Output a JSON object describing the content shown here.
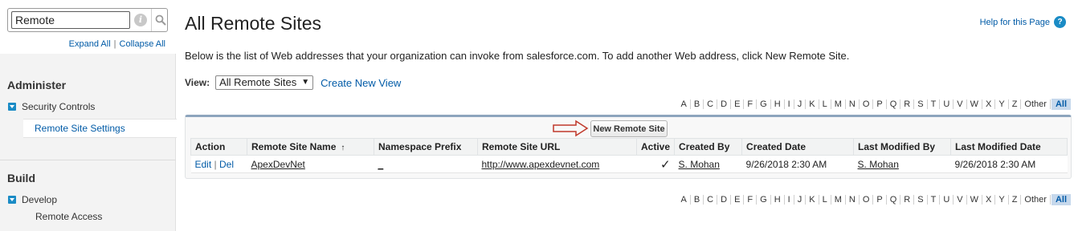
{
  "search": {
    "value": "Remote",
    "info_glyph": "i"
  },
  "sidebar": {
    "expand_all": "Expand All",
    "collapse_all": "Collapse All",
    "separator": "|",
    "sections": [
      {
        "title": "Administer",
        "groups": [
          {
            "label": "Security Controls",
            "items": [
              "Remote Site Settings"
            ]
          }
        ]
      },
      {
        "title": "Build",
        "groups": [
          {
            "label": "Develop",
            "items": [
              "Remote Access"
            ]
          }
        ]
      }
    ]
  },
  "header": {
    "title": "All Remote Sites",
    "help": "Help for this Page",
    "help_glyph": "?"
  },
  "description": "Below is the list of Web addresses that your organization can invoke from salesforce.com. To add another Web address, click New Remote Site.",
  "view": {
    "label": "View:",
    "selected": "All Remote Sites",
    "create_new": "Create New View"
  },
  "alphabet": [
    "A",
    "B",
    "C",
    "D",
    "E",
    "F",
    "G",
    "H",
    "I",
    "J",
    "K",
    "L",
    "M",
    "N",
    "O",
    "P",
    "Q",
    "R",
    "S",
    "T",
    "U",
    "V",
    "W",
    "X",
    "Y",
    "Z",
    "Other"
  ],
  "alphabet_all": "All",
  "new_button": "New Remote Site",
  "table": {
    "headers": [
      "Action",
      "Remote Site Name",
      "Namespace Prefix",
      "Remote Site URL",
      "Active",
      "Created By",
      "Created Date",
      "Last Modified By",
      "Last Modified Date"
    ],
    "sort_glyph": "↑",
    "rows": [
      {
        "edit": "Edit",
        "sep": "|",
        "del": "Del",
        "name": "ApexDevNet",
        "namespace": "_",
        "url": "http://www.apexdevnet.com",
        "active": "✓",
        "created_by": "S. Mohan",
        "created_date": "9/26/2018 2:30 AM",
        "modified_by": "S. Mohan",
        "modified_date": "9/26/2018 2:30 AM"
      }
    ]
  },
  "colors": {
    "link": "#015ba7",
    "accent": "#1a8bc5",
    "panel_border": "#8da5bd",
    "annotation_arrow": "#c0392b"
  }
}
